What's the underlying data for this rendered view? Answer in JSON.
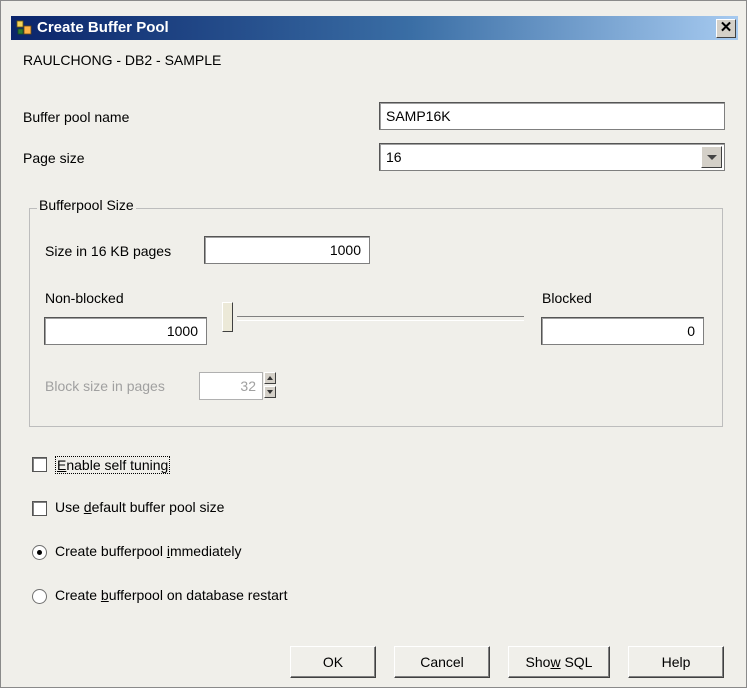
{
  "window": {
    "title": "Create Buffer Pool",
    "close_glyph": "✕"
  },
  "context_label": "RAULCHONG - DB2 - SAMPLE",
  "buffer_pool_name": {
    "label": "Buffer pool name",
    "value": "SAMP16K"
  },
  "page_size": {
    "label": "Page size",
    "value": "16"
  },
  "bufferpool_size": {
    "group_label": "Bufferpool Size",
    "size_label": "Size in 16 KB pages",
    "size_value": "1000",
    "non_blocked_label": "Non-blocked",
    "non_blocked_value": "1000",
    "blocked_label": "Blocked",
    "blocked_value": "0",
    "slider_position_fraction": 0,
    "block_size_label": "Block size in pages",
    "block_size_value": "32"
  },
  "options": {
    "enable_self_tuning": {
      "pre": "",
      "key": "E",
      "post": "nable self tuning",
      "checked": false
    },
    "use_default_size": {
      "pre": "Use ",
      "key": "d",
      "post": "efault buffer pool size",
      "checked": false
    },
    "create_immediately": {
      "pre": "Create bufferpool ",
      "key": "i",
      "post": "mmediately",
      "selected": true
    },
    "create_on_restart": {
      "pre": "Create ",
      "key": "b",
      "post": "ufferpool on database restart",
      "selected": false
    }
  },
  "buttons": {
    "ok": "OK",
    "cancel": "Cancel",
    "show_sql_pre": "Sho",
    "show_sql_key": "w",
    "show_sql_post": " SQL",
    "help": "Help"
  },
  "icons": {
    "title_icon": "buffer-pool-icon"
  }
}
